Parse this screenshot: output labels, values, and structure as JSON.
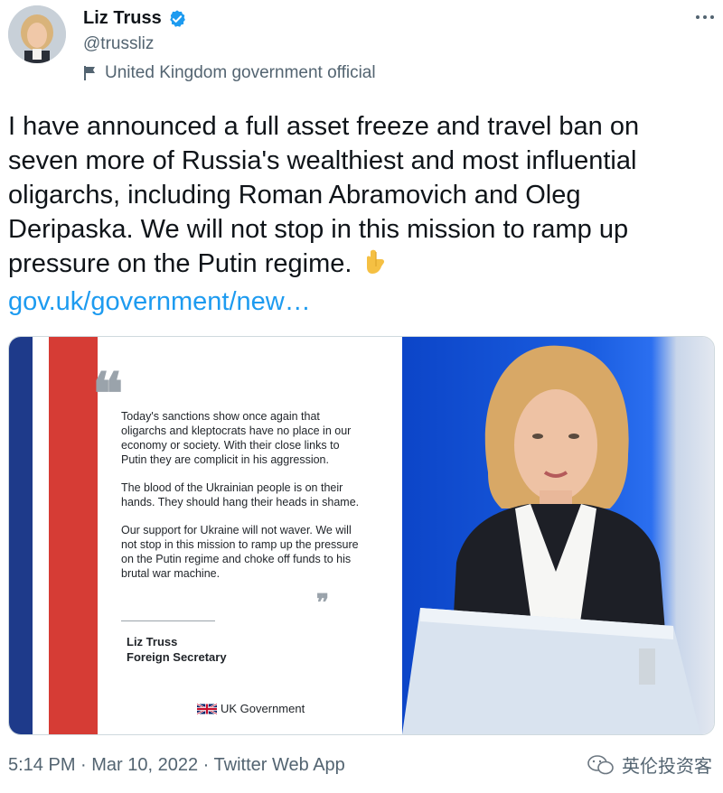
{
  "author": {
    "name": "Liz Truss",
    "handle": "@trussliz",
    "label": "United Kingdom government official"
  },
  "tweet": {
    "text": "I have announced a full asset freeze and travel ban on seven more of Russia's wealthiest and most influential oligarchs, including Roman Abramovich and Oleg Deripaska. We will not stop in this mission to ramp up pressure on the Putin regime.",
    "emoji": "👇",
    "link": "gov.uk/government/new…"
  },
  "media": {
    "quote_paragraphs": [
      "Today's sanctions show once again that oligarchs and kleptocrats have no place in our economy or society. With their close links to Putin they are complicit in his aggression.",
      "The blood of the Ukrainian people is on their hands. They should hang their heads in shame.",
      "Our support for Ukraine will not waver. We will not stop in this mission to ramp up the pressure on the Putin regime and choke off funds to his brutal war machine."
    ],
    "quote_open": "❝",
    "quote_close": "❞",
    "signature_name": "Liz Truss",
    "signature_role": "Foreign Secretary",
    "org": "UK Government"
  },
  "footer": {
    "meta": "5:14 PM · Mar 10, 2022 · Twitter Web App"
  },
  "watermark": {
    "text": "英伦投资客"
  },
  "icons": {
    "verified": "verified-badge-icon",
    "flag": "government-flag-icon",
    "more": "more-dots-icon",
    "wechat": "wechat-icon"
  },
  "colors": {
    "link": "#1d9bf0",
    "verified": "#1d9bf0",
    "secondary_text": "#536471",
    "union_red": "#d63c35",
    "union_blue": "#1e3a8a"
  }
}
